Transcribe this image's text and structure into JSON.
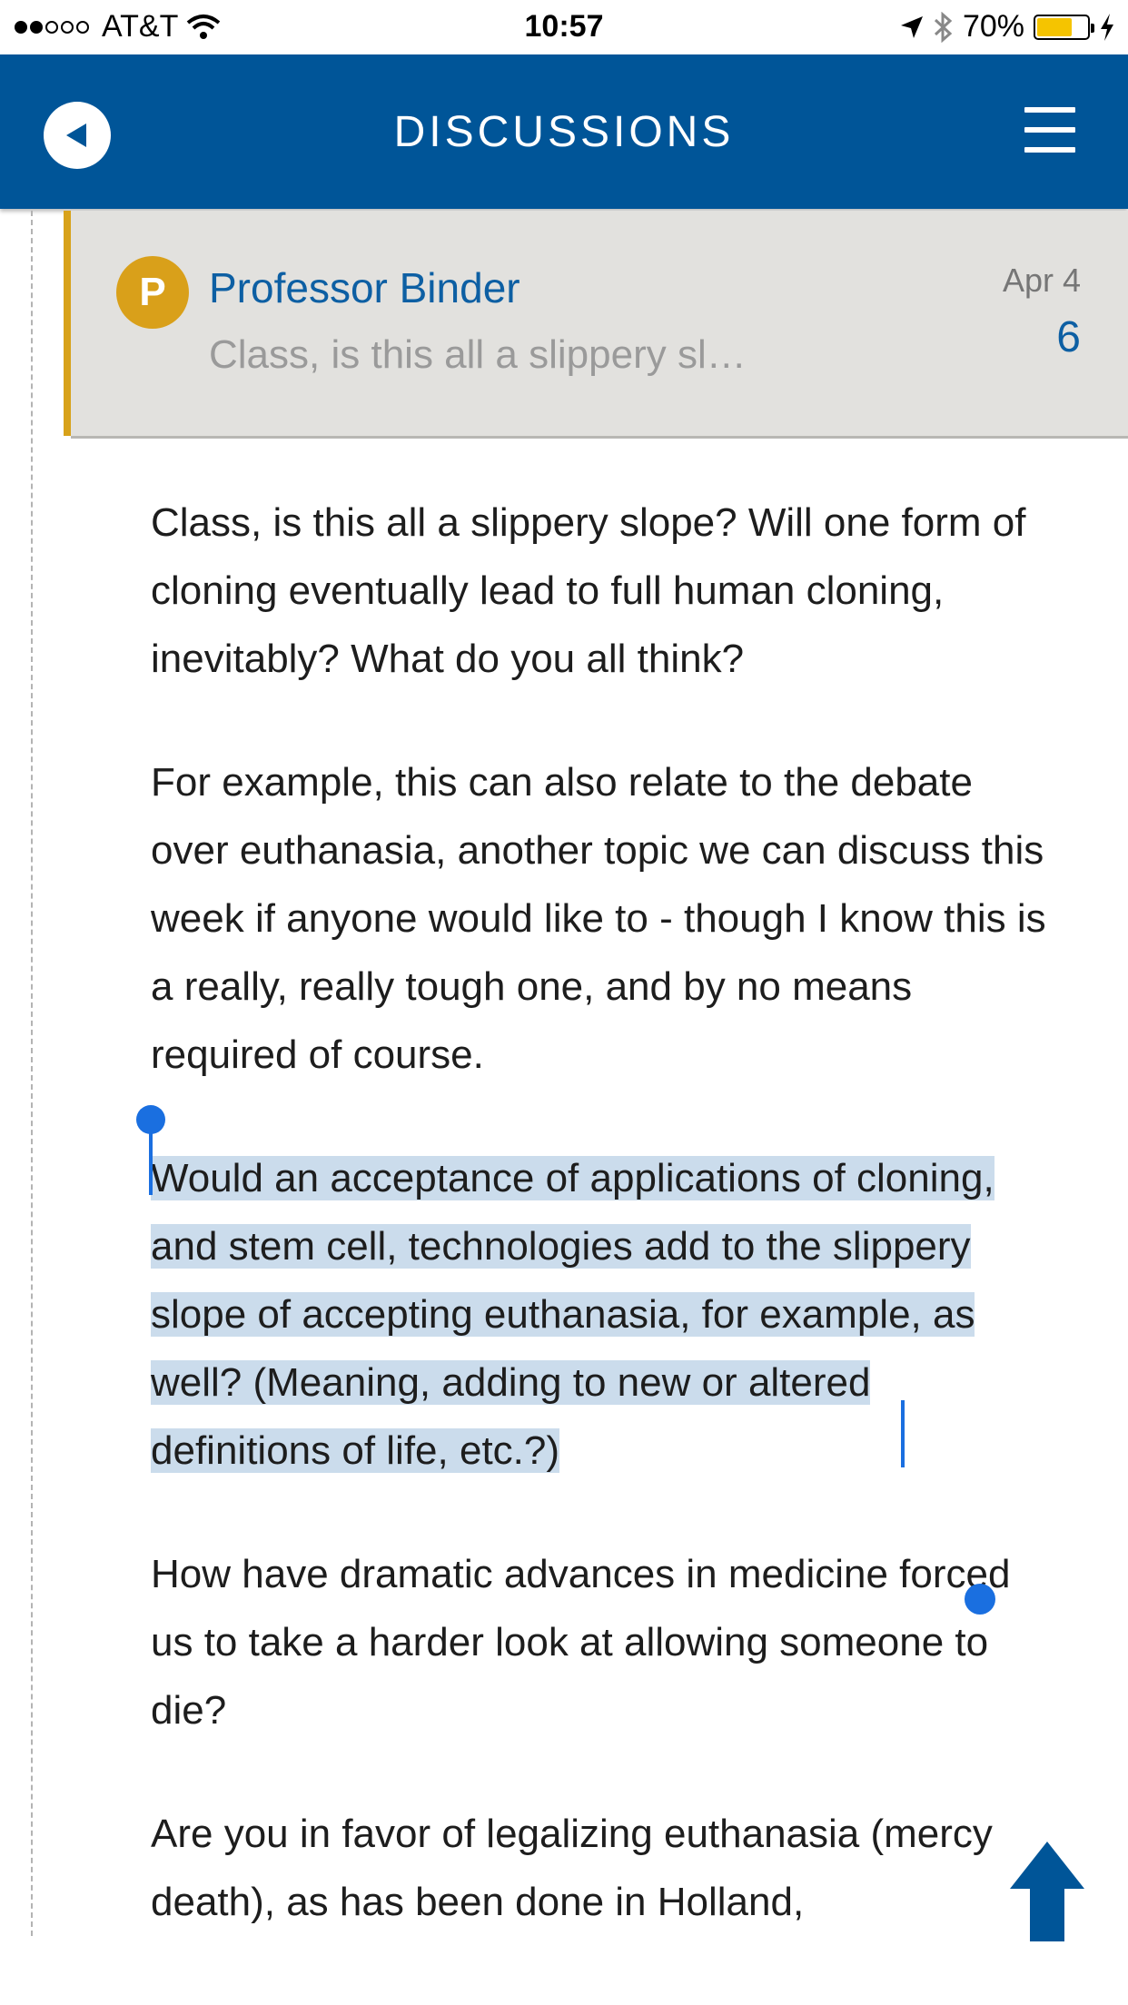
{
  "status_bar": {
    "carrier": "AT&T",
    "time": "10:57",
    "battery_percent": "70%",
    "signal_bars_filled": 2,
    "signal_bars_total": 5,
    "battery_fill_fraction": 0.7
  },
  "nav": {
    "title": "DISCUSSIONS",
    "back_icon": "back-arrow-icon",
    "menu_icon": "hamburger-icon"
  },
  "post": {
    "avatar_letter": "P",
    "author": "Professor Binder",
    "preview": "Class, is this all a slippery sl…",
    "date": "Apr 4",
    "reply_count": "6"
  },
  "body": {
    "paragraphs": [
      "Class, is this all a slippery slope? Will one form of cloning eventually lead to full human cloning, inevitably? What do you all think?",
      "For example, this can also relate to the debate over euthanasia, another topic we can discuss this week if anyone would like to - though I know this is a really, really tough one, and by no means required of course.",
      "Would an acceptance of applications of cloning, and stem cell, technologies add to the slippery slope of accepting euthanasia, for example, as well? (Meaning, adding to new or altered definitions of life, etc.?)",
      "How have dramatic advances in medicine forced us to take a harder look at allowing someone to die?",
      "Are you in favor of legalizing euthanasia (mercy death), as has been done in Holland,"
    ]
  },
  "colors": {
    "nav_blue": "#005598",
    "accent_gold": "#d9a01a",
    "link_blue": "#0d5fa3",
    "selection": "#cbdcec"
  }
}
